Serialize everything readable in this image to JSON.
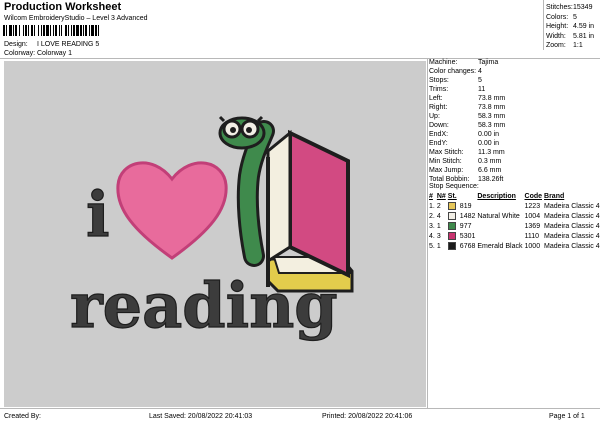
{
  "header": {
    "title": "Production Worksheet",
    "subtitle": "Wilcom EmbroideryStudio – Level 3 Advanced",
    "design_label": "Design:",
    "design_value": "I LOVE READING 5",
    "colorway_label": "Colorway:",
    "colorway_value": "Colorway 1"
  },
  "stats": [
    {
      "label": "Stitches:",
      "value": "15349"
    },
    {
      "label": "Colors:",
      "value": "5"
    },
    {
      "label": "Height:",
      "value": "4.59 in"
    },
    {
      "label": "Width:",
      "value": "5.81 in"
    },
    {
      "label": "Zoom:",
      "value": "1:1"
    }
  ],
  "machine_info": [
    {
      "label": "Machine:",
      "value": "Tajima"
    },
    {
      "label": "Color changes:",
      "value": "4"
    },
    {
      "label": "Stops:",
      "value": "5"
    },
    {
      "label": "Trims:",
      "value": "11"
    },
    {
      "label": "Left:",
      "value": "73.8 mm"
    },
    {
      "label": "Right:",
      "value": "73.8 mm"
    },
    {
      "label": "Up:",
      "value": "58.3 mm"
    },
    {
      "label": "Down:",
      "value": "58.3 mm"
    },
    {
      "label": "EndX:",
      "value": "0.00 in"
    },
    {
      "label": "EndY:",
      "value": "0.00 in"
    },
    {
      "label": "Max Stitch:",
      "value": "11.3 mm"
    },
    {
      "label": "Min Stitch:",
      "value": "0.3 mm"
    },
    {
      "label": "Max Jump:",
      "value": "6.6 mm"
    },
    {
      "label": "Total Bobbin:",
      "value": "138.26ft"
    }
  ],
  "stop_sequence": {
    "heading": "Stop Sequence:",
    "columns": [
      "#",
      "N#",
      "St.",
      "Description",
      "Code",
      "Brand"
    ],
    "rows": [
      {
        "stop": "1.",
        "needle": "2",
        "color": "#e6c75a",
        "code_num": "819",
        "stitches": "1223",
        "description": "",
        "brand": "Madeira Classic 40"
      },
      {
        "stop": "2.",
        "needle": "4",
        "color": "#f2efe6",
        "code_num": "1482",
        "stitches": "1004",
        "description": "Natural White",
        "brand": "Madeira Classic 40"
      },
      {
        "stop": "3.",
        "needle": "1",
        "color": "#3f8a4c",
        "code_num": "977",
        "stitches": "1369",
        "description": "",
        "brand": "Madeira Classic 40"
      },
      {
        "stop": "4.",
        "needle": "3",
        "color": "#c8336f",
        "code_num": "5301",
        "stitches": "1110",
        "description": "",
        "brand": "Madeira Classic 40"
      },
      {
        "stop": "5.",
        "needle": "1",
        "color": "#1c1c1c",
        "code_num": "6768",
        "stitches": "1000",
        "description": "Emerald Black",
        "brand": "Madeira Classic 40"
      }
    ]
  },
  "design_preview": {
    "letter_i": "i",
    "word": "reading",
    "colors": {
      "heart": "#e86b9c",
      "heart_outline": "#c23f78",
      "text": "#3c3c3c",
      "book_pink": "#d24a82",
      "book_yellow": "#e2cc4c",
      "worm_green": "#3f8a4c",
      "canvas_bg": "#cccccc"
    }
  },
  "footer": {
    "created_by": "Created By:",
    "last_saved": "Last Saved: 20/08/2022 20:41:03",
    "printed": "Printed: 20/08/2022 20:41:06",
    "page": "Page 1 of 1"
  }
}
